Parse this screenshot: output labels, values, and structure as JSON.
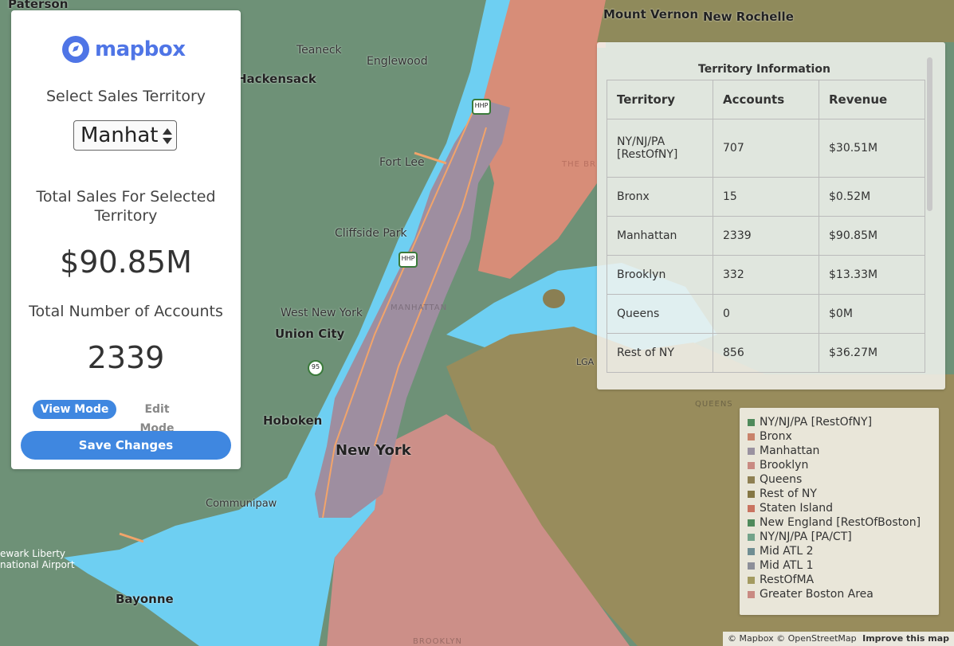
{
  "panel": {
    "logo_text": "mapbox",
    "select_label": "Select Sales Territory",
    "select_value": "Manhat",
    "total_sales_label": "Total Sales For Selected Territory",
    "total_sales_value": "$90.85M",
    "accounts_label": "Total Number of Accounts",
    "accounts_value": "2339",
    "view_mode": "View Mode",
    "edit_mode": "Edit Mode",
    "save_button": "Save Changes"
  },
  "info": {
    "title": "Territory Information",
    "headers": [
      "Territory",
      "Accounts",
      "Revenue"
    ],
    "rows": [
      [
        "NY/NJ/PA [RestOfNY]",
        "707",
        "$30.51M"
      ],
      [
        "Bronx",
        "15",
        "$0.52M"
      ],
      [
        "Manhattan",
        "2339",
        "$90.85M"
      ],
      [
        "Brooklyn",
        "332",
        "$13.33M"
      ],
      [
        "Queens",
        "0",
        "$0M"
      ],
      [
        "Rest of NY",
        "856",
        "$36.27M"
      ]
    ]
  },
  "legend": {
    "items": [
      {
        "label": "NY/NJ/PA [RestOfNY]",
        "color": "#4f8a5b"
      },
      {
        "label": "Bronx",
        "color": "#c9836b"
      },
      {
        "label": "Manhattan",
        "color": "#9a92a0"
      },
      {
        "label": "Brooklyn",
        "color": "#c98a82"
      },
      {
        "label": "Queens",
        "color": "#8e7f52"
      },
      {
        "label": "Rest of NY",
        "color": "#857744"
      },
      {
        "label": "Staten Island",
        "color": "#c97460"
      },
      {
        "label": "New England [RestOfBoston]",
        "color": "#4f8a5b"
      },
      {
        "label": "NY/NJ/PA [PA/CT]",
        "color": "#73a38a"
      },
      {
        "label": "Mid ATL 2",
        "color": "#6f8d92"
      },
      {
        "label": "Mid ATL 1",
        "color": "#8d8f99"
      },
      {
        "label": "RestOfMA",
        "color": "#a39a60"
      },
      {
        "label": "Greater Boston Area",
        "color": "#c98a82"
      }
    ]
  },
  "map_labels": {
    "paterson": "Paterson",
    "teaneck": "Teaneck",
    "englewood": "Englewood",
    "hackensack": "Hackensack",
    "fort_lee": "Fort Lee",
    "cliffside_park": "Cliffside Park",
    "west_new_york": "West New York",
    "union_city": "Union City",
    "hoboken": "Hoboken",
    "new_york": "New York",
    "manhattan": "MANHATTAN",
    "communipaw": "Communipaw",
    "bayonne": "Bayonne",
    "newark_airport": "ewark Liberty\nnational Airport",
    "mount_vernon": "Mount Vernon",
    "new_rochelle": "New Rochelle",
    "queens": "QUEENS",
    "the_bronx": "THE BR",
    "lga": "LGA",
    "brooklyn": "BROOKLYN"
  },
  "attribution": {
    "mapbox": "© Mapbox",
    "osm": "© OpenStreetMap",
    "improve": "Improve this map"
  }
}
